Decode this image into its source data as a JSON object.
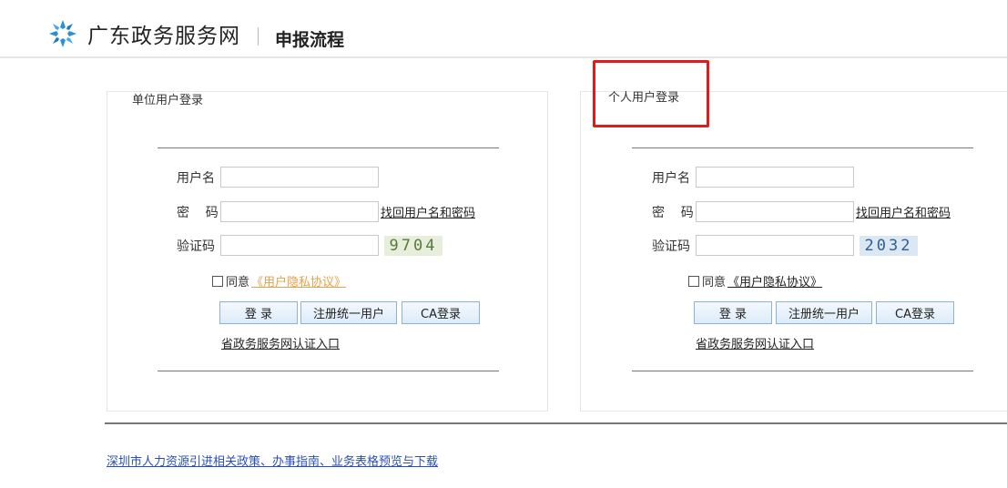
{
  "header": {
    "site_title": "广东政务服务网",
    "page_title": "申报流程",
    "logo_icon": "gd-gov-snowflake-logo-icon"
  },
  "unit_login": {
    "title": "单位用户登录",
    "username_label": "用户名",
    "username_value": "",
    "password_label": "密    码",
    "password_value": "",
    "forgot_link": "找回用户名和密码",
    "captcha_label": "验证码",
    "captcha_value": "",
    "captcha_image_text": "9704",
    "agree_label": "同意",
    "agree_link": "《用户隐私协议》",
    "login_button": "登 录",
    "register_button": "注册统一用户",
    "ca_login_button": "CA登录",
    "cert_link": "省政务服务网认证入口"
  },
  "personal_login": {
    "title": "个人用户登录",
    "username_label": "用户名",
    "username_value": "",
    "password_label": "密    码",
    "password_value": "",
    "forgot_link": "找回用户名和密码",
    "captcha_label": "验证码",
    "captcha_value": "",
    "captcha_image_text": "2032",
    "agree_label": "同意",
    "agree_link": "《用户隐私协议》",
    "login_button": "登 录",
    "register_button": "注册统一用户",
    "ca_login_button": "CA登录",
    "cert_link": "省政务服务网认证入口"
  },
  "footer": {
    "link": "深圳市人力资源引进相关政策、办事指南、业务表格预览与下载"
  },
  "colors": {
    "highlight_border": "#e01b1b",
    "link_blue": "#2a4fb8",
    "agreement_orange": "#e8a04a"
  }
}
